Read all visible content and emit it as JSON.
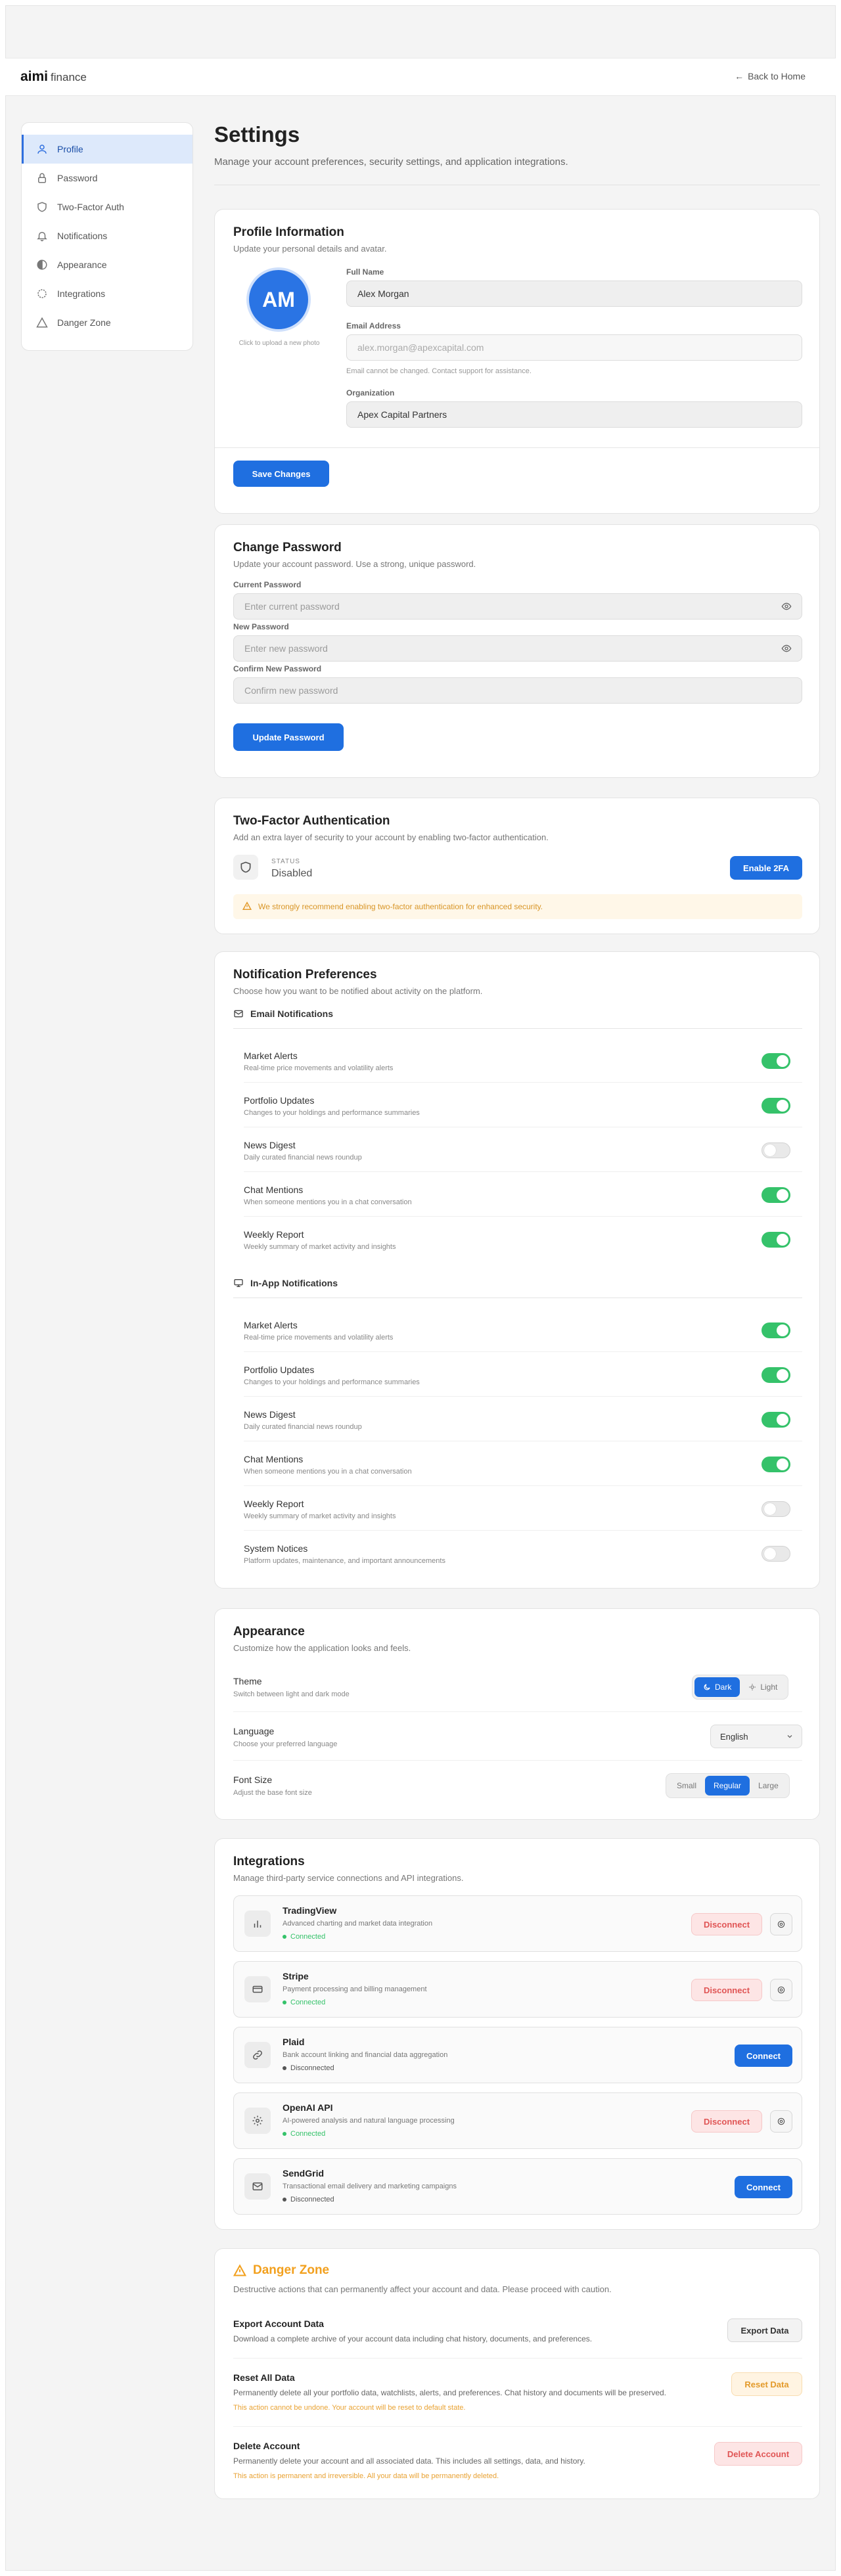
{
  "app": {
    "brand": "aimi",
    "brand_sub": "finance",
    "back_label": "Back to Home"
  },
  "sidebar": {
    "items": [
      {
        "label": "Profile",
        "icon": "user-icon",
        "active": true
      },
      {
        "label": "Password",
        "icon": "lock-icon"
      },
      {
        "label": "Two-Factor Auth",
        "icon": "shield-icon"
      },
      {
        "label": "Notifications",
        "icon": "bell-icon"
      },
      {
        "label": "Appearance",
        "icon": "palette-icon"
      },
      {
        "label": "Integrations",
        "icon": "plug-icon"
      },
      {
        "label": "Danger Zone",
        "icon": "warning-icon"
      }
    ]
  },
  "page": {
    "title": "Settings",
    "subtitle": "Manage your account preferences, security settings, and application integrations."
  },
  "profile": {
    "title": "Profile Information",
    "subtitle": "Update your personal details and avatar.",
    "initials": "AM",
    "avatar_hint": "Click to upload a new photo",
    "full_name_label": "Full Name",
    "full_name": "Alex Morgan",
    "email_label": "Email Address",
    "email": "alex.morgan@apexcapital.com",
    "email_hint": "Email cannot be changed. Contact support for assistance.",
    "org_label": "Organization",
    "org": "Apex Capital Partners",
    "save_label": "Save Changes"
  },
  "password": {
    "title": "Change Password",
    "subtitle": "Update your account password. Use a strong, unique password.",
    "current_label": "Current Password",
    "current_placeholder": "Enter current password",
    "new_label": "New Password",
    "new_placeholder": "Enter new password",
    "confirm_label": "Confirm New Password",
    "confirm_placeholder": "Confirm new password",
    "update_label": "Update Password"
  },
  "twofa": {
    "title": "Two-Factor Authentication",
    "subtitle": "Add an extra layer of security to your account by enabling two-factor authentication.",
    "status_label": "STATUS",
    "status": "Disabled",
    "enable_label": "Enable 2FA",
    "warning": "We strongly recommend enabling two-factor authentication for enhanced security."
  },
  "notifications": {
    "title": "Notification Preferences",
    "subtitle": "Choose how you want to be notified about activity on the platform.",
    "email_heading": "Email Notifications",
    "email_items": [
      {
        "title": "Market Alerts",
        "desc": "Real-time price movements and volatility alerts",
        "on": true
      },
      {
        "title": "Portfolio Updates",
        "desc": "Changes to your holdings and performance summaries",
        "on": true
      },
      {
        "title": "News Digest",
        "desc": "Daily curated financial news roundup",
        "on": false
      },
      {
        "title": "Chat Mentions",
        "desc": "When someone mentions you in a chat conversation",
        "on": true
      },
      {
        "title": "Weekly Report",
        "desc": "Weekly summary of market activity and insights",
        "on": true
      }
    ],
    "inapp_heading": "In-App Notifications",
    "inapp_items": [
      {
        "title": "Market Alerts",
        "desc": "Real-time price movements and volatility alerts",
        "on": true
      },
      {
        "title": "Portfolio Updates",
        "desc": "Changes to your holdings and performance summaries",
        "on": true
      },
      {
        "title": "News Digest",
        "desc": "Daily curated financial news roundup",
        "on": true
      },
      {
        "title": "Chat Mentions",
        "desc": "When someone mentions you in a chat conversation",
        "on": true
      },
      {
        "title": "Weekly Report",
        "desc": "Weekly summary of market activity and insights",
        "on": false
      },
      {
        "title": "System Notices",
        "desc": "Platform updates, maintenance, and important announcements",
        "on": false
      }
    ]
  },
  "appearance": {
    "title": "Appearance",
    "subtitle": "Customize how the application looks and feels.",
    "theme_title": "Theme",
    "theme_desc": "Switch between light and dark mode",
    "theme_dark": "Dark",
    "theme_light": "Light",
    "language_title": "Language",
    "language_desc": "Choose your preferred language",
    "language_value": "English",
    "font_title": "Font Size",
    "font_desc": "Adjust the base font size",
    "font_small": "Small",
    "font_regular": "Regular",
    "font_large": "Large"
  },
  "integrations": {
    "title": "Integrations",
    "subtitle": "Manage third-party service connections and API integrations.",
    "connected_color": "#35c26a",
    "disconnected_color": "#555555",
    "items": [
      {
        "name": "TradingView",
        "desc": "Advanced charting and market data integration",
        "status": "Connected",
        "action": "Disconnect",
        "icon": "bar-chart-icon"
      },
      {
        "name": "Stripe",
        "desc": "Payment processing and billing management",
        "status": "Connected",
        "action": "Disconnect",
        "icon": "credit-card-icon"
      },
      {
        "name": "Plaid",
        "desc": "Bank account linking and financial data aggregation",
        "status": "Disconnected",
        "action": "Connect",
        "icon": "link-icon"
      },
      {
        "name": "OpenAI API",
        "desc": "AI-powered analysis and natural language processing",
        "status": "Connected",
        "action": "Disconnect",
        "icon": "gear-icon"
      },
      {
        "name": "SendGrid",
        "desc": "Transactional email delivery and marketing campaigns",
        "status": "Disconnected",
        "action": "Connect",
        "icon": "mail-icon"
      }
    ]
  },
  "danger": {
    "title": "Danger Zone",
    "subtitle": "Destructive actions that can permanently affect your account and data. Please proceed with caution.",
    "export_title": "Export Account Data",
    "export_desc": "Download a complete archive of your account data including chat history, documents, and preferences.",
    "export_label": "Export Data",
    "reset_title": "Reset All Data",
    "reset_desc": "Permanently delete all your portfolio data, watchlists, alerts, and preferences. Chat history and documents will be preserved.",
    "reset_warn": "This action cannot be undone. Your account will be reset to default state.",
    "reset_label": "Reset Data",
    "delete_title": "Delete Account",
    "delete_desc": "Permanently delete your account and all associated data. This includes all settings, data, and history.",
    "delete_warn": "This action is permanent and irreversible. All your data will be permanently deleted.",
    "delete_label": "Delete Account"
  }
}
